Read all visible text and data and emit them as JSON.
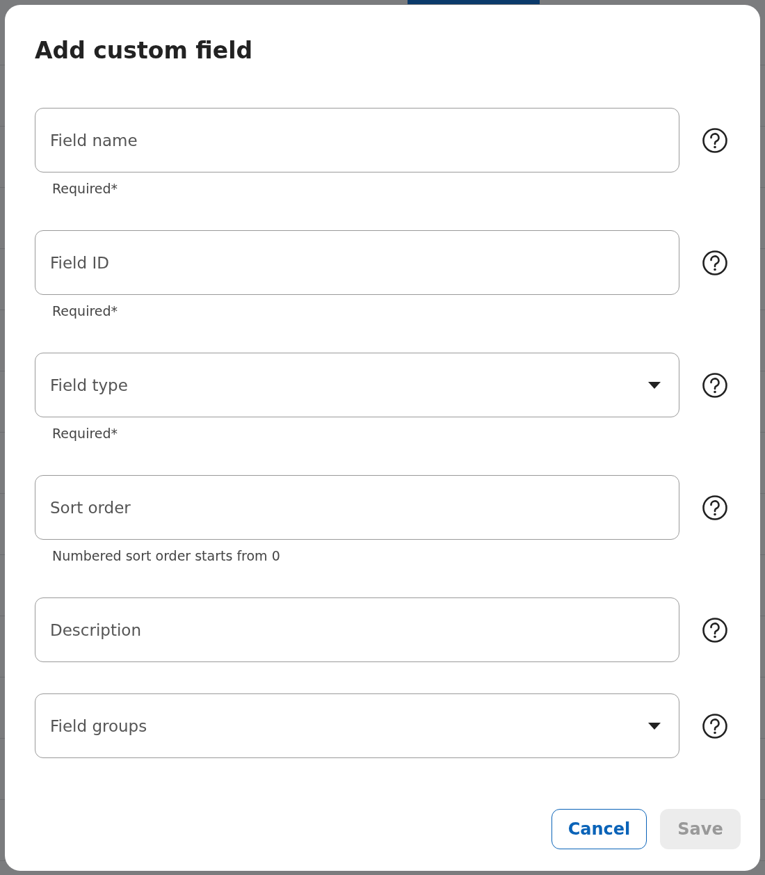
{
  "dialog": {
    "title": "Add custom field"
  },
  "fields": [
    {
      "kind": "text",
      "placeholder": "Field name",
      "helper": "Required*"
    },
    {
      "kind": "text",
      "placeholder": "Field ID",
      "helper": "Required*"
    },
    {
      "kind": "select",
      "placeholder": "Field type",
      "helper": "Required*"
    },
    {
      "kind": "text",
      "placeholder": "Sort order",
      "helper": "Numbered sort order starts from 0"
    },
    {
      "kind": "text",
      "placeholder": "Description"
    },
    {
      "kind": "select",
      "placeholder": "Field groups"
    }
  ],
  "buttons": [
    {
      "kind": "secondary",
      "label": "Cancel",
      "disabled": false
    },
    {
      "kind": "primary",
      "label": "Save",
      "disabled": true
    }
  ]
}
